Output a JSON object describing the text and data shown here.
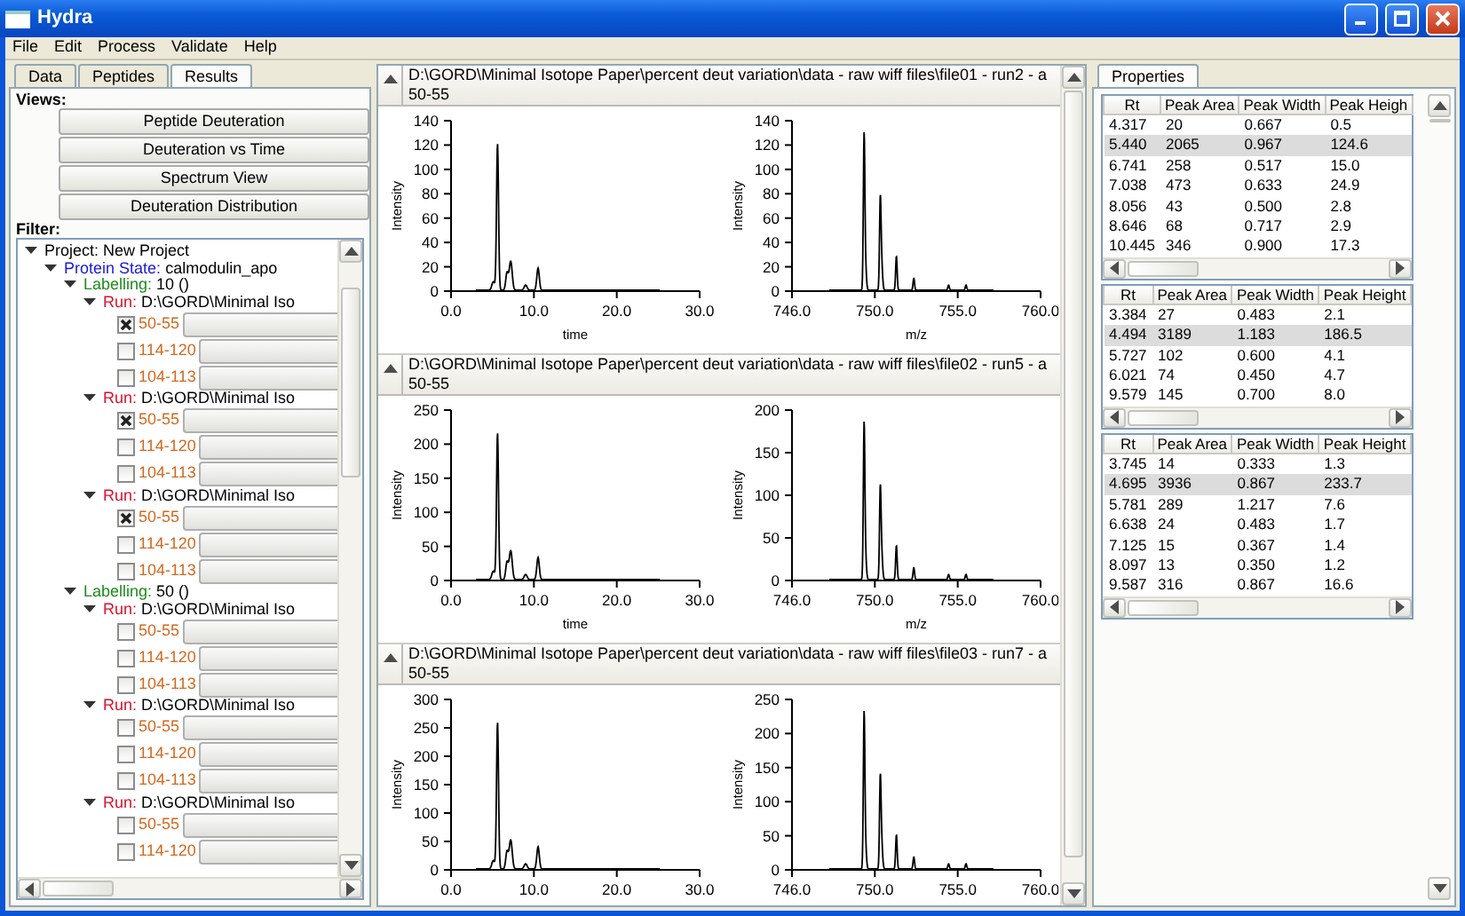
{
  "window": {
    "title": "Hydra"
  },
  "menu": [
    "File",
    "Edit",
    "Process",
    "Validate",
    "Help"
  ],
  "left_panel": {
    "tabs": [
      {
        "label": "Data",
        "selected": false
      },
      {
        "label": "Peptides",
        "selected": false
      },
      {
        "label": "Results",
        "selected": true
      }
    ],
    "views_label": "Views:",
    "view_buttons": [
      "Peptide Deuteration",
      "Deuteration vs Time",
      "Spectrum View",
      "Deuteration Distribution"
    ],
    "filter_label": "Filter:",
    "tree": [
      {
        "kind": "project",
        "label": "Project:",
        "value": "New Project",
        "expanded": true,
        "children": [
          {
            "kind": "protein_state",
            "label": "Protein State:",
            "value": "calmodulin_apo",
            "expanded": true,
            "children": [
              {
                "kind": "labelling",
                "label": "Labelling:",
                "value": "10 ()",
                "expanded": true,
                "children": [
                  {
                    "kind": "run",
                    "label": "Run:",
                    "value": "D:\\GORD\\Minimal Iso",
                    "expanded": true,
                    "children": [
                      {
                        "kind": "peptide",
                        "label": "50-55",
                        "checked": true
                      },
                      {
                        "kind": "peptide",
                        "label": "114-120",
                        "checked": false
                      },
                      {
                        "kind": "peptide",
                        "label": "104-113",
                        "checked": false
                      }
                    ]
                  },
                  {
                    "kind": "run",
                    "label": "Run:",
                    "value": "D:\\GORD\\Minimal Iso",
                    "expanded": true,
                    "children": [
                      {
                        "kind": "peptide",
                        "label": "50-55",
                        "checked": true
                      },
                      {
                        "kind": "peptide",
                        "label": "114-120",
                        "checked": false
                      },
                      {
                        "kind": "peptide",
                        "label": "104-113",
                        "checked": false
                      }
                    ]
                  },
                  {
                    "kind": "run",
                    "label": "Run:",
                    "value": "D:\\GORD\\Minimal Iso",
                    "expanded": true,
                    "children": [
                      {
                        "kind": "peptide",
                        "label": "50-55",
                        "checked": true
                      },
                      {
                        "kind": "peptide",
                        "label": "114-120",
                        "checked": false
                      },
                      {
                        "kind": "peptide",
                        "label": "104-113",
                        "checked": false
                      }
                    ]
                  }
                ]
              },
              {
                "kind": "labelling",
                "label": "Labelling:",
                "value": "50 ()",
                "expanded": true,
                "children": [
                  {
                    "kind": "run",
                    "label": "Run:",
                    "value": "D:\\GORD\\Minimal Iso",
                    "expanded": true,
                    "children": [
                      {
                        "kind": "peptide",
                        "label": "50-55",
                        "checked": false
                      },
                      {
                        "kind": "peptide",
                        "label": "114-120",
                        "checked": false
                      },
                      {
                        "kind": "peptide",
                        "label": "104-113",
                        "checked": false
                      }
                    ]
                  },
                  {
                    "kind": "run",
                    "label": "Run:",
                    "value": "D:\\GORD\\Minimal Iso",
                    "expanded": true,
                    "children": [
                      {
                        "kind": "peptide",
                        "label": "50-55",
                        "checked": false
                      },
                      {
                        "kind": "peptide",
                        "label": "114-120",
                        "checked": false
                      },
                      {
                        "kind": "peptide",
                        "label": "104-113",
                        "checked": false
                      }
                    ]
                  },
                  {
                    "kind": "run",
                    "label": "Run:",
                    "value": "D:\\GORD\\Minimal Iso",
                    "expanded": true,
                    "children": [
                      {
                        "kind": "peptide",
                        "label": "50-55",
                        "checked": false
                      },
                      {
                        "kind": "peptide",
                        "label": "114-120",
                        "checked": false
                      }
                    ]
                  }
                ]
              }
            ]
          }
        ]
      }
    ]
  },
  "spectra_panels": [
    {
      "path": "D:\\GORD\\Minimal Isotope Paper\\percent deut variation\\data - raw wiff files\\file01 - run2 - a",
      "peptide": "50-55",
      "expanded": true,
      "charts": [
        {
          "kind": "chromatogram",
          "ylabel": "Intensity",
          "yticks": [
            "140",
            "120",
            "100",
            "80",
            "60",
            "40",
            "20",
            "0"
          ],
          "xticks": [
            "0.0",
            "10.0",
            "20.0",
            "30.0"
          ],
          "xlabel": "time"
        },
        {
          "kind": "spectrum",
          "ylabel": "Intensity",
          "yticks": [
            "140",
            "120",
            "100",
            "80",
            "60",
            "40",
            "20",
            "0"
          ],
          "xticks": [
            "746.0",
            "750.0",
            "755.0",
            "760.0"
          ],
          "xlabel": "m/z"
        }
      ]
    },
    {
      "path": "D:\\GORD\\Minimal Isotope Paper\\percent deut variation\\data - raw wiff files\\file02 - run5 - a",
      "peptide": "50-55",
      "expanded": true,
      "charts": [
        {
          "kind": "chromatogram",
          "ylabel": "Intensity",
          "yticks": [
            "250",
            "200",
            "150",
            "100",
            "50",
            "0"
          ],
          "xticks": [
            "0.0",
            "10.0",
            "20.0",
            "30.0"
          ],
          "xlabel": "time"
        },
        {
          "kind": "spectrum",
          "ylabel": "Intensity",
          "yticks": [
            "200",
            "150",
            "100",
            "50",
            "0"
          ],
          "xticks": [
            "746.0",
            "750.0",
            "755.0",
            "760.0"
          ],
          "xlabel": "m/z"
        }
      ]
    },
    {
      "path": "D:\\GORD\\Minimal Isotope Paper\\percent deut variation\\data - raw wiff files\\file03 - run7 - a",
      "peptide": "50-55",
      "expanded": true,
      "charts": [
        {
          "kind": "chromatogram",
          "ylabel": "Intensity",
          "yticks": [
            "300",
            "250",
            "200",
            "150",
            "100",
            "50",
            "0"
          ],
          "xticks": [
            "0.0",
            "10.0",
            "20.0",
            "30.0"
          ]
        },
        {
          "kind": "spectrum",
          "ylabel": "Intensity",
          "yticks": [
            "250",
            "200",
            "150",
            "100",
            "50",
            "0"
          ],
          "xticks": [
            "746.0",
            "750.0",
            "755.0",
            "760.0"
          ]
        }
      ]
    }
  ],
  "properties_panel": {
    "tabs": [
      {
        "label": "Properties",
        "selected": true
      }
    ],
    "tables": [
      {
        "columns": [
          "Rt",
          "Peak Area",
          "Peak Width",
          "Peak Heigh"
        ],
        "rows": [
          {
            "cells": [
              "4.317",
              "20",
              "0.667",
              "0.5"
            ],
            "selected": false
          },
          {
            "cells": [
              "5.440",
              "2065",
              "0.967",
              "124.6"
            ],
            "selected": true
          },
          {
            "cells": [
              "6.741",
              "258",
              "0.517",
              "15.0"
            ],
            "selected": false
          },
          {
            "cells": [
              "7.038",
              "473",
              "0.633",
              "24.9"
            ],
            "selected": false
          },
          {
            "cells": [
              "8.056",
              "43",
              "0.500",
              "2.8"
            ],
            "selected": false
          },
          {
            "cells": [
              "8.646",
              "68",
              "0.717",
              "2.9"
            ],
            "selected": false
          },
          {
            "cells": [
              "10.445",
              "346",
              "0.900",
              "17.3"
            ],
            "selected": false
          }
        ]
      },
      {
        "columns": [
          "Rt",
          "Peak Area",
          "Peak Width",
          "Peak Height"
        ],
        "rows": [
          {
            "cells": [
              "3.384",
              "27",
              "0.483",
              "2.1"
            ],
            "selected": false
          },
          {
            "cells": [
              "4.494",
              "3189",
              "1.183",
              "186.5"
            ],
            "selected": true
          },
          {
            "cells": [
              "5.727",
              "102",
              "0.600",
              "4.1"
            ],
            "selected": false
          },
          {
            "cells": [
              "6.021",
              "74",
              "0.450",
              "4.7"
            ],
            "selected": false
          },
          {
            "cells": [
              "9.579",
              "145",
              "0.700",
              "8.0"
            ],
            "selected": false
          }
        ]
      },
      {
        "columns": [
          "Rt",
          "Peak Area",
          "Peak Width",
          "Peak Height"
        ],
        "rows": [
          {
            "cells": [
              "3.745",
              "14",
              "0.333",
              "1.3"
            ],
            "selected": false
          },
          {
            "cells": [
              "4.695",
              "3936",
              "0.867",
              "233.7"
            ],
            "selected": true
          },
          {
            "cells": [
              "5.781",
              "289",
              "1.217",
              "7.6"
            ],
            "selected": false
          },
          {
            "cells": [
              "6.638",
              "24",
              "0.483",
              "1.7"
            ],
            "selected": false
          },
          {
            "cells": [
              "7.125",
              "15",
              "0.367",
              "1.4"
            ],
            "selected": false
          },
          {
            "cells": [
              "8.097",
              "13",
              "0.350",
              "1.2"
            ],
            "selected": false
          },
          {
            "cells": [
              "9.587",
              "316",
              "0.867",
              "16.6"
            ],
            "selected": false
          }
        ]
      }
    ]
  }
}
